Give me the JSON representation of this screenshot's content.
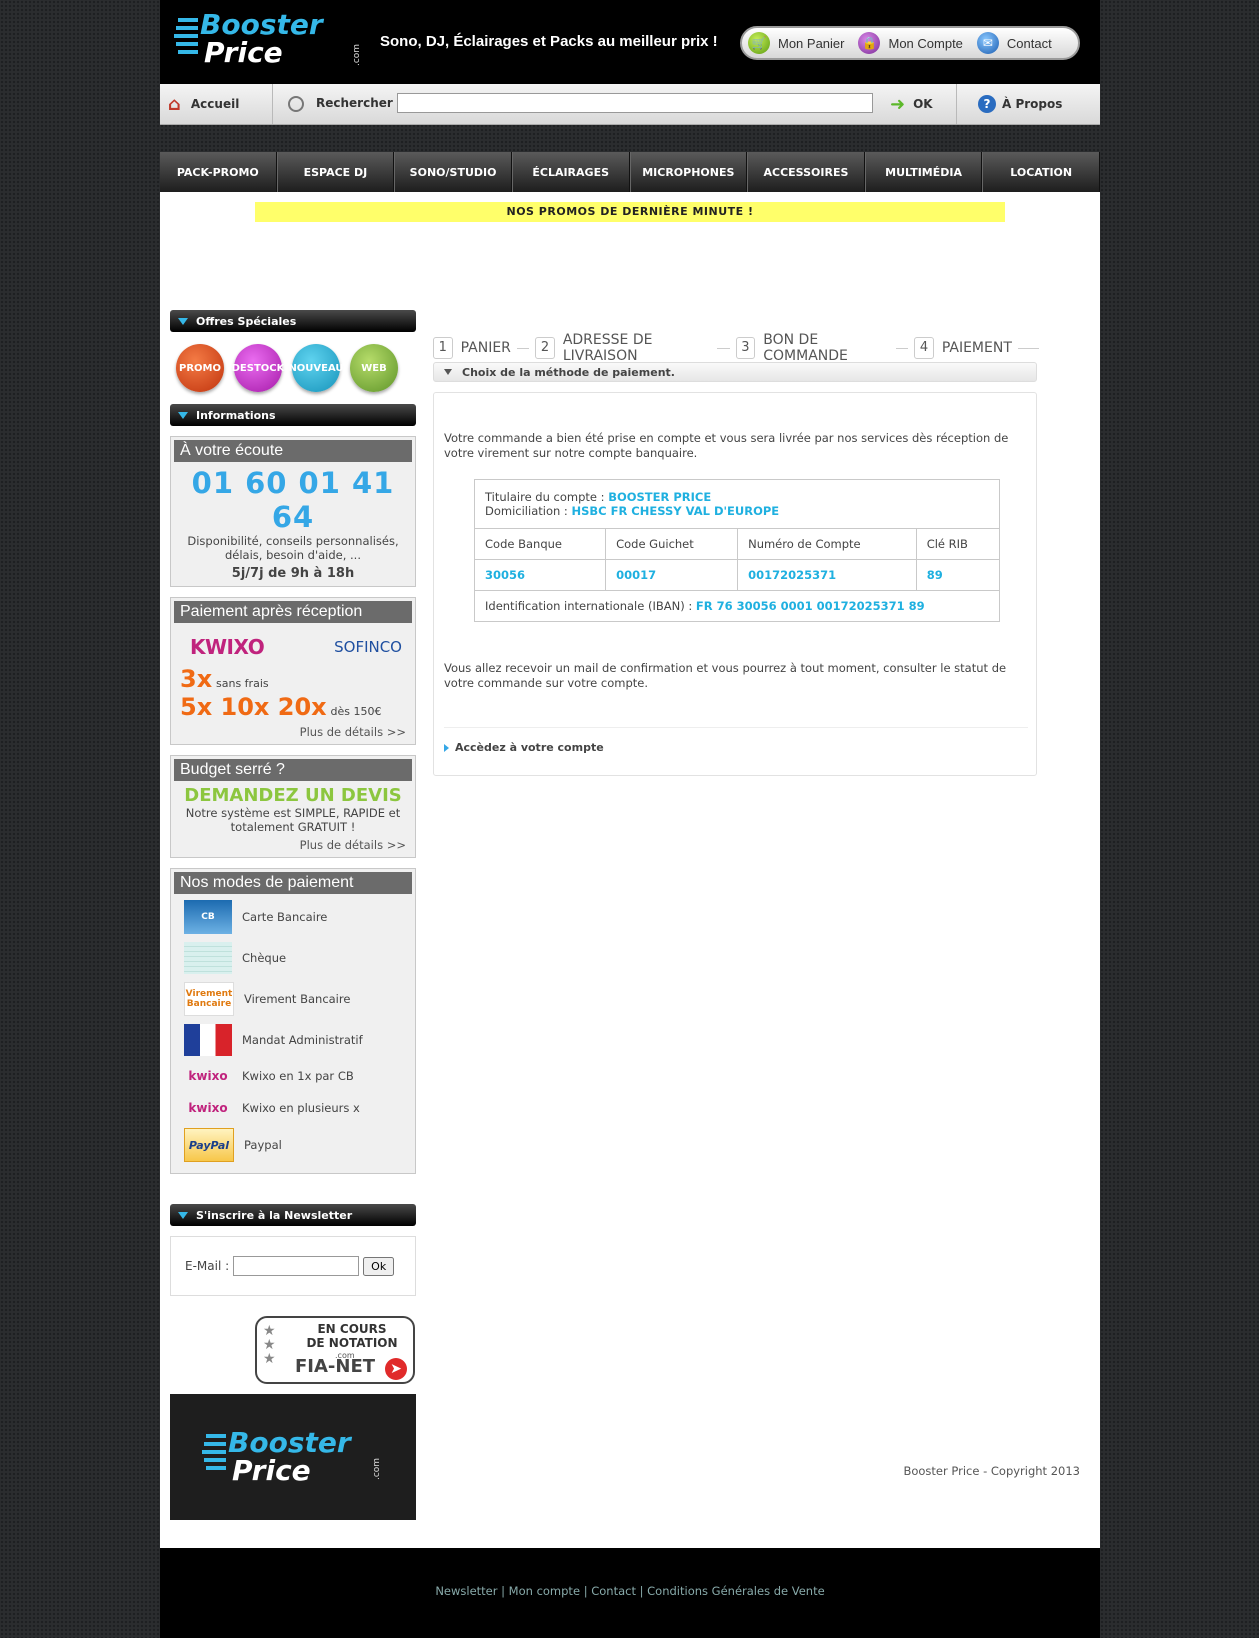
{
  "header": {
    "logo_line1": "Booster",
    "logo_line2": "Price",
    "logo_com": ".com",
    "tagline": "Sono, DJ, Éclairages et Packs au meilleur prix !",
    "links": {
      "cart": "Mon Panier",
      "account": "Mon Compte",
      "contact": "Contact"
    }
  },
  "searchbar": {
    "home": "Accueil",
    "search_label": "Rechercher",
    "search_value": "",
    "ok": "OK",
    "about": "À Propos"
  },
  "nav": [
    "PACK-PROMO",
    "ESPACE DJ",
    "SONO/STUDIO",
    "ÉCLAIRAGES",
    "MICROPHONES",
    "ACCESSOIRES",
    "MULTIMÉDIA",
    "LOCATION"
  ],
  "promo_banner": "NOS PROMOS DE DERNIÈRE MINUTE !",
  "sidebar": {
    "offers_title": "Offres Spéciales",
    "badges": [
      "PROMO",
      "DESTOCK",
      "NOUVEAU",
      "WEB"
    ],
    "info_title": "Informations",
    "listen": {
      "head": "À votre écoute",
      "phone": "01 60 01 41 64",
      "text": "Disponibilité, conseils personnalisés, délais, besoin d'aide, ...",
      "hours": "5j/7j de 9h à 18h"
    },
    "payment_after": {
      "head": "Paiement après réception",
      "brand1": "KWIXO",
      "brand2": "SOFINCO",
      "x3": "3x",
      "x3_note": "sans frais",
      "multi": "5x 10x 20x",
      "multi_note": "dès 150€",
      "more": "Plus de détails >>"
    },
    "budget": {
      "head": "Budget serré ?",
      "cta": "DEMANDEZ UN DEVIS",
      "text": "Notre système est SIMPLE, RAPIDE et totalement GRATUIT !",
      "more": "Plus de détails >>"
    },
    "payment_modes": {
      "head": "Nos modes de paiement",
      "items": [
        "Carte Bancaire",
        "Chèque",
        "Virement Bancaire",
        "Mandat Administratif",
        "Kwixo en 1x par CB",
        "Kwixo en plusieurs x",
        "Paypal"
      ],
      "icons": [
        "CB",
        "",
        "Virement Bancaire",
        "",
        "kwixo",
        "kwixo",
        "PayPal"
      ]
    },
    "newsletter": {
      "title": "S'inscrire à la Newsletter",
      "label": "E-Mail :",
      "value": "",
      "ok": "Ok"
    },
    "fianet": {
      "line1": "EN COURS",
      "line2": "DE NOTATION",
      "com": ".com",
      "brand": "FIA-NET"
    },
    "bottom_logo1": "Booster",
    "bottom_logo2": "Price",
    "bottom_logo_com": ".com"
  },
  "steps": [
    {
      "num": "1",
      "label": "PANIER"
    },
    {
      "num": "2",
      "label": "ADRESSE DE LIVRAISON"
    },
    {
      "num": "3",
      "label": "BON DE COMMANDE"
    },
    {
      "num": "4",
      "label": "PAIEMENT"
    }
  ],
  "payment": {
    "section_title": "Choix de la méthode de paiement.",
    "intro": "Votre commande a bien été prise en compte et vous sera livrée par nos services dès réception de votre virement sur notre compte banquaire.",
    "holder_label": "Titulaire du compte :",
    "holder": "BOOSTER PRICE",
    "domicile_label": "Domiciliation :",
    "domicile": "HSBC FR CHESSY VAL D'EUROPE",
    "headers": [
      "Code Banque",
      "Code Guichet",
      "Numéro de Compte",
      "Clé RIB"
    ],
    "values": [
      "30056",
      "00017",
      "00172025371",
      "89"
    ],
    "iban_label": "Identification internationale (IBAN) :",
    "iban": "FR 76 30056 0001 00172025371 89",
    "outro": "Vous allez recevoir un mail de confirmation et vous pourrez à tout moment, consulter le statut de votre commande sur votre compte.",
    "account_link": "Accèdez à votre compte"
  },
  "copyright": "Booster Price - Copyright 2013",
  "footer": {
    "links": [
      "Newsletter",
      "Mon compte",
      "Contact",
      "Conditions Générales de Vente"
    ],
    "sep": "|"
  }
}
